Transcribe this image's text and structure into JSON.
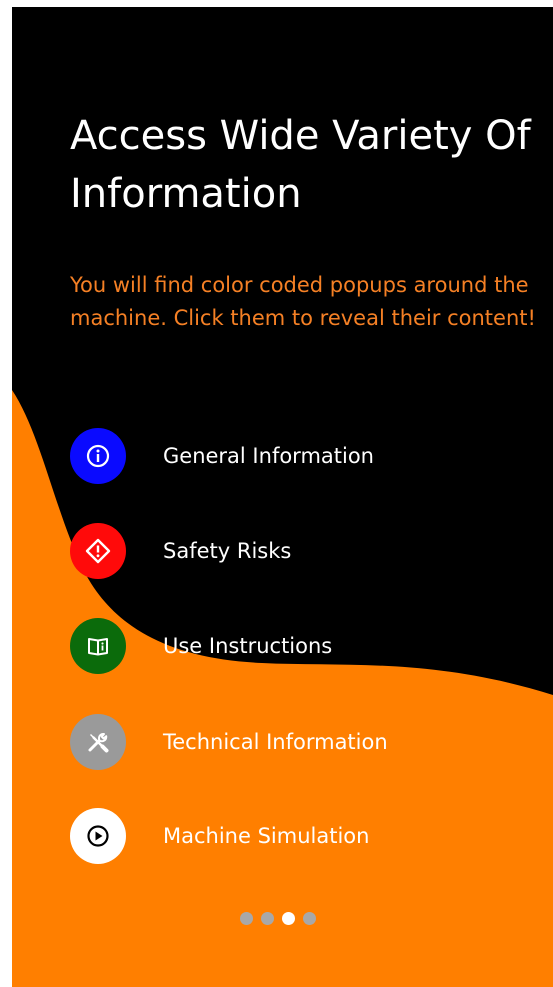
{
  "onboarding": {
    "title": "Access Wide Variety Of Information",
    "subtitle": "You will find color coded popups around the machine. Click them to reveal their content!",
    "items": [
      {
        "label": "General Information",
        "icon": "info-icon",
        "color": "#0a0aff"
      },
      {
        "label": "Safety Risks",
        "icon": "warning-diamond-icon",
        "color": "#ff0a0a"
      },
      {
        "label": "Use Instructions",
        "icon": "book-icon",
        "color": "#0b6b0b"
      },
      {
        "label": "Technical Information",
        "icon": "tools-icon",
        "color": "#9a9a9a"
      },
      {
        "label": "Machine Simulation",
        "icon": "play-icon",
        "color": "#ffffff"
      }
    ],
    "pagination": {
      "total": 4,
      "current": 3
    }
  },
  "colors": {
    "background": "#000000",
    "accent": "#ff7f00",
    "subtitle": "#f58025"
  }
}
